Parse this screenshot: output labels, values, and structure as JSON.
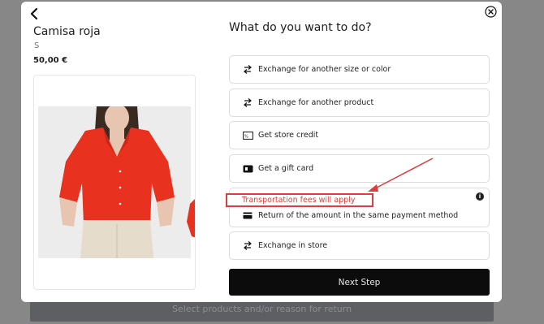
{
  "background": {
    "bottom_button_label": "Select products and/or reason for return"
  },
  "product": {
    "name": "Camisa roja",
    "size": "S",
    "price": "50,00 €"
  },
  "question": "What do you want to do?",
  "options": [
    {
      "label": "Exchange for another size or color",
      "icon": "exchange-arrows-icon"
    },
    {
      "label": "Exchange for another product",
      "icon": "exchange-arrows-icon"
    },
    {
      "label": "Get store credit",
      "icon": "store-credit-icon"
    },
    {
      "label": "Get a gift card",
      "icon": "gift-card-icon"
    },
    {
      "label": "Return of the amount in the same payment method",
      "icon": "credit-card-icon",
      "note": "Transportation fees will apply",
      "info_icon": "info-icon"
    },
    {
      "label": "Exchange in store",
      "icon": "exchange-arrows-icon"
    }
  ],
  "next_button_label": "Next Step",
  "colors": {
    "annotation_red": "#e23b3b",
    "shirt_red": "#e8311f",
    "button_black": "#0c0c0c"
  }
}
